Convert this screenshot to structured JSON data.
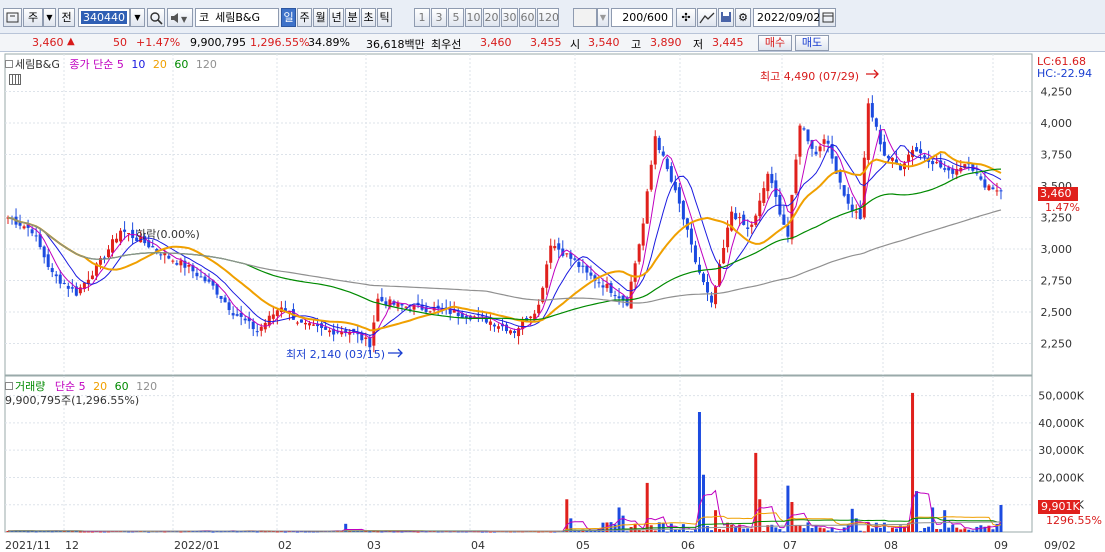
{
  "toolbar": {
    "type_label": "주",
    "prev_label": "전",
    "stock_code": "340440",
    "code_prefix": "코",
    "stock_name": "세림B&G",
    "periods": [
      "일",
      "주",
      "월",
      "년",
      "분",
      "초",
      "틱"
    ],
    "selected_period": "일",
    "intervals": [
      "1",
      "3",
      "5",
      "10",
      "20",
      "30",
      "60",
      "120"
    ],
    "count": "200/600",
    "date": "2022/09/02"
  },
  "quote": {
    "price": "3,460",
    "change_arrow": "▲",
    "change": "50",
    "change_pct": "+1.47%",
    "volume": "9,900,795",
    "volume_ratio": "1,296.55%",
    "turnover": "34.89%",
    "amount": "36,618백만",
    "best_ask_label": "최우선",
    "best_ask": "3,460",
    "best_bid": "3,455",
    "open_label": "시",
    "open": "3,540",
    "high_label": "고",
    "high": "3,890",
    "low_label": "저",
    "low": "3,445",
    "buy_label": "매수",
    "sell_label": "매도"
  },
  "price_legend": {
    "name": "세림B&G",
    "ma_label": "종가 단순",
    "ma_periods": [
      "5",
      "10",
      "20",
      "60",
      "120"
    ],
    "ma_colors": [
      "#c000c0",
      "#1a1ae0",
      "#f0a000",
      "#008a00",
      "#909090"
    ]
  },
  "volume_legend": {
    "name": "거래량",
    "ma_label": "단순",
    "ma_periods": [
      "5",
      "20",
      "60",
      "120"
    ],
    "info": "9,900,795주(1,296.55%)"
  },
  "annotations": {
    "high": "최고 4,490 (07/29)",
    "low": "최저 2,140 (03/15)",
    "drop": "하락(0.00%)"
  },
  "right_labels": {
    "lc": "LC:61.68",
    "hc": "HC:-22.94",
    "price_tag": "3,460",
    "price_pct": "1.47%",
    "vol_tag": "9,901K",
    "vol_pct": "1296.55%"
  },
  "chart_data": {
    "type": "candlestick",
    "price_axis": {
      "ylim": [
        2000,
        4500
      ],
      "ticks": [
        2250,
        2500,
        2750,
        3000,
        3250,
        3500,
        3750,
        4000,
        4250
      ]
    },
    "price_tick_labels": [
      "2,250",
      "2,500",
      "2,750",
      "3,000",
      "3,250",
      "3,500",
      "3,750",
      "4,000",
      "4,250"
    ],
    "volume_axis": {
      "ylim": [
        0,
        55000
      ],
      "ticks": [
        10000,
        20000,
        30000,
        40000,
        50000
      ]
    },
    "volume_tick_labels": [
      "10,000K",
      "20,000K",
      "30,000K",
      "40,000K",
      "50,000K"
    ],
    "x_labels": [
      "2021/11",
      "12",
      "2022/01",
      "02",
      "03",
      "04",
      "05",
      "06",
      "07",
      "08",
      "09",
      "09/02"
    ],
    "close_keypoints": [
      [
        0,
        3250
      ],
      [
        5,
        3150
      ],
      [
        10,
        2800
      ],
      [
        15,
        2650
      ],
      [
        20,
        2900
      ],
      [
        25,
        3150
      ],
      [
        30,
        3050
      ],
      [
        35,
        2950
      ],
      [
        40,
        2850
      ],
      [
        45,
        2700
      ],
      [
        50,
        2500
      ],
      [
        55,
        2350
      ],
      [
        60,
        2550
      ],
      [
        65,
        2400
      ],
      [
        70,
        2350
      ],
      [
        75,
        2350
      ],
      [
        80,
        2250
      ],
      [
        82,
        2600
      ],
      [
        86,
        2550
      ],
      [
        95,
        2520
      ],
      [
        105,
        2450
      ],
      [
        112,
        2350
      ],
      [
        117,
        2550
      ],
      [
        120,
        3050
      ],
      [
        125,
        2900
      ],
      [
        128,
        2800
      ],
      [
        132,
        2700
      ],
      [
        137,
        2580
      ],
      [
        140,
        3200
      ],
      [
        143,
        3900
      ],
      [
        148,
        3350
      ],
      [
        152,
        2900
      ],
      [
        155,
        2550
      ],
      [
        158,
        3000
      ],
      [
        160,
        3300
      ],
      [
        163,
        3150
      ],
      [
        165,
        3250
      ],
      [
        168,
        3600
      ],
      [
        170,
        3300
      ],
      [
        172,
        3100
      ],
      [
        175,
        4000
      ],
      [
        178,
        3750
      ],
      [
        180,
        3900
      ],
      [
        185,
        3350
      ],
      [
        188,
        3250
      ],
      [
        190,
        4150
      ],
      [
        193,
        3750
      ],
      [
        197,
        3650
      ],
      [
        200,
        3800
      ],
      [
        204,
        3700
      ],
      [
        208,
        3600
      ],
      [
        212,
        3700
      ],
      [
        215,
        3530
      ],
      [
        220,
        3460
      ]
    ],
    "volume_spikes": [
      [
        84,
        3000
      ],
      [
        139,
        12000
      ],
      [
        140,
        5000
      ],
      [
        152,
        9000
      ],
      [
        153,
        6000
      ],
      [
        159,
        18000
      ],
      [
        172,
        44000
      ],
      [
        173,
        21000
      ],
      [
        176,
        8000
      ],
      [
        186,
        29000
      ],
      [
        187,
        12000
      ],
      [
        194,
        17000
      ],
      [
        195,
        11000
      ],
      [
        210,
        8500
      ],
      [
        211,
        5000
      ],
      [
        225,
        51000
      ],
      [
        226,
        15000
      ],
      [
        230,
        9000
      ],
      [
        233,
        8000
      ],
      [
        247,
        9901
      ]
    ]
  }
}
